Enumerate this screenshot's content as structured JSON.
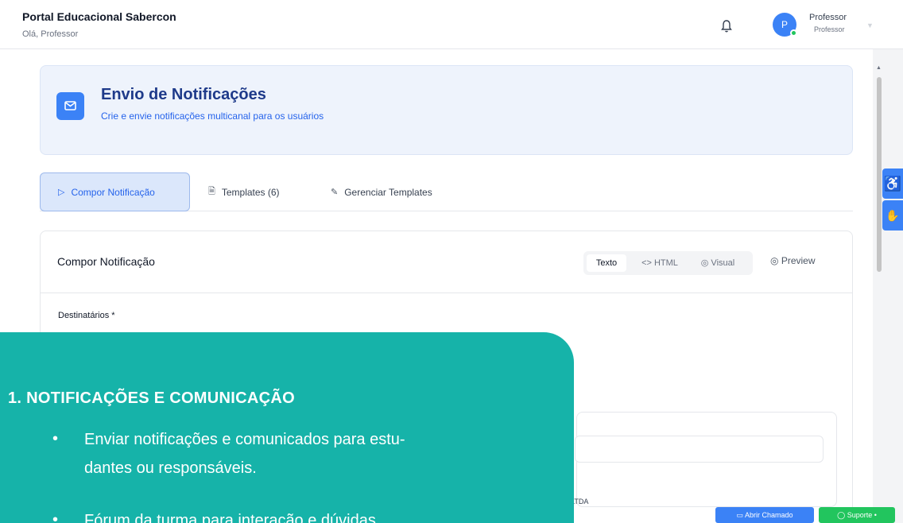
{
  "header": {
    "app_title": "Portal Educacional Sabercon",
    "greeting": "Olá, Professor",
    "user_name": "Professor",
    "user_role": "Professor",
    "avatar_initial": "P"
  },
  "hero": {
    "title": "Envio de Notificações",
    "subtitle": "Crie e envie notificações multicanal para os usuários"
  },
  "tabs": [
    {
      "label": "Compor Notificação",
      "active": true,
      "icon": "send-icon"
    },
    {
      "label": "Templates (6)",
      "active": false,
      "icon": "document-icon"
    },
    {
      "label": "Gerenciar Templates",
      "active": false,
      "icon": "pencil-icon"
    }
  ],
  "compose": {
    "title": "Compor Notificação",
    "modes": [
      "Texto",
      "<> HTML",
      "◎ Visual"
    ],
    "active_mode": "Texto",
    "preview_label": "Preview",
    "recipients_label": "Destinatários *",
    "partial_text": "LTDA"
  },
  "overlay": {
    "heading": "1.  NOTIFICAÇÕES E COMUNICAÇÃO",
    "items": [
      "Enviar notificações e comunicados para estu-",
      "dantes ou responsáveis.",
      "Fórum da turma para interação e dúvidas."
    ]
  },
  "footer_buttons": {
    "chamado": "Abrir Chamado",
    "suporte": "Suporte •"
  },
  "colors": {
    "primary": "#3b82f6",
    "overlay": "#16b3a9",
    "success": "#22c55e"
  }
}
